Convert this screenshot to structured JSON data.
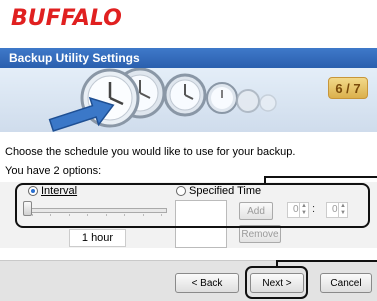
{
  "brand": {
    "logo_text": "BUFFALO",
    "color": "#e02020"
  },
  "header": {
    "title": "Backup Utility Settings",
    "step": "6 / 7"
  },
  "instructions": {
    "line1": "Choose the schedule you would like to use for your backup.",
    "line2": "You have 2 options:"
  },
  "options": {
    "interval": {
      "label": "Interval",
      "selected": true,
      "value_text": "1 hour",
      "slider_position": 0
    },
    "specified_time": {
      "label": "Specified Time",
      "selected": false,
      "add_label": "Add",
      "remove_label": "Remove",
      "hour": "0",
      "minute": "0",
      "separator": ":"
    }
  },
  "footer": {
    "back_label": "< Back",
    "next_label": "Next >",
    "cancel_label": "Cancel"
  },
  "icons": [
    "clock-icon",
    "backup-arrow-icon"
  ],
  "colors": {
    "accent": "#2a5fae",
    "step_badge": "#dbb04c"
  }
}
